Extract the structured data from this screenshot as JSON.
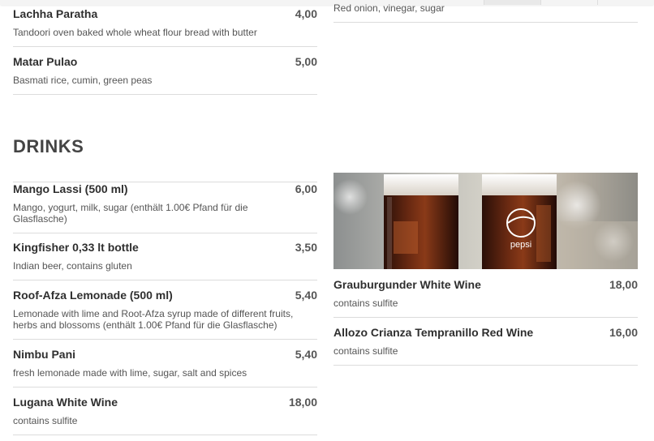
{
  "menu": {
    "top_items": [
      {
        "name": "Lachha Paratha",
        "price": "4,00",
        "description": "Tandoori oven baked whole wheat flour bread with butter"
      },
      {
        "name": "Matar Pulao",
        "price": "5,00",
        "description": "Basmati rice, cumin, green peas"
      }
    ],
    "right_top_description": "Red onion, vinegar, sugar",
    "drinks_section": {
      "title": "DRINKS",
      "left_items": [
        {
          "name": "Mango Lassi (500 ml)",
          "price": "6,00",
          "description": "Mango, yogurt, milk, sugar (enthält 1.00€ Pfand für die Glasflasche)"
        },
        {
          "name": "Kingfisher 0,33 lt bottle",
          "price": "3,50",
          "description": "Indian beer, contains gluten"
        },
        {
          "name": "Roof-Afza Lemonade (500 ml)",
          "price": "5,40",
          "description": "Lemonade with lime and Root-Afza syrup made of different fruits, herbs and blossoms (enthält 1.00€ Pfand für die Glasflasche)"
        },
        {
          "name": "Nimbu Pani",
          "price": "5,40",
          "description": "fresh lemonade made with lime, sugar, salt and spices"
        },
        {
          "name": "Lugana White Wine",
          "price": "18,00",
          "description": "contains sulfite"
        }
      ],
      "right_items": [
        {
          "name": "Grauburgunder White Wine",
          "price": "18,00",
          "description": "contains sulfite"
        },
        {
          "name": "Allozo Crianza Tempranillo Red Wine",
          "price": "16,00",
          "description": "contains sulfite"
        }
      ],
      "photo": {
        "brand_text": "pepsi"
      }
    }
  }
}
